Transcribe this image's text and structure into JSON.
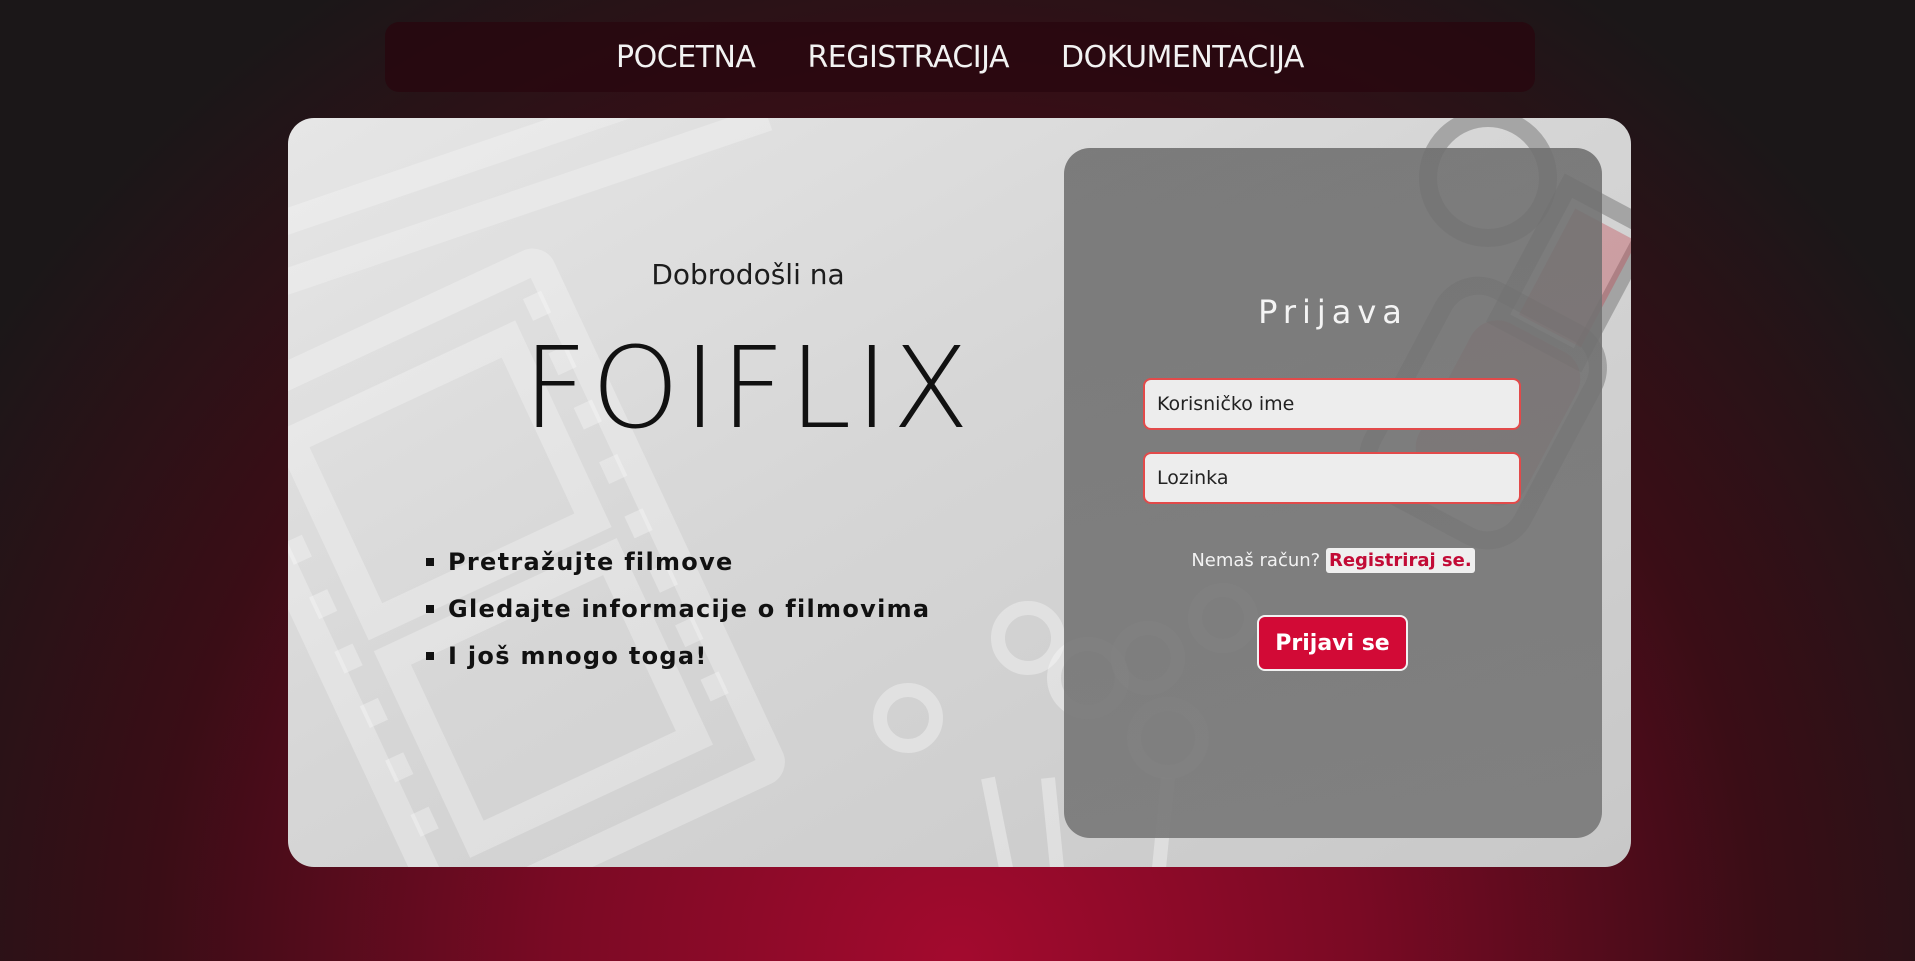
{
  "nav": {
    "items": [
      {
        "label": "POCETNA"
      },
      {
        "label": "REGISTRACIJA"
      },
      {
        "label": "DOKUMENTACIJA"
      }
    ]
  },
  "hero": {
    "welcome": "Dobrodošli na",
    "brand": "FOIFLIX",
    "features": [
      "Pretražujte filmove",
      "Gledajte informacije o filmovima",
      "I još mnogo toga!"
    ]
  },
  "login": {
    "title": "Prijava",
    "username_placeholder": "Korisničko ime",
    "password_placeholder": "Lozinka",
    "no_account_text": "Nemaš račun?",
    "register_link": "Registriraj se.",
    "submit_label": "Prijavi se"
  },
  "icons": {
    "background_left": "film-strip-icon",
    "background_popcorn": "popcorn-icon",
    "background_camera": "movie-camera-icon"
  },
  "colors": {
    "accent": "#d20a36",
    "field_border": "#e24a4a",
    "nav_bg": "#28060e"
  }
}
